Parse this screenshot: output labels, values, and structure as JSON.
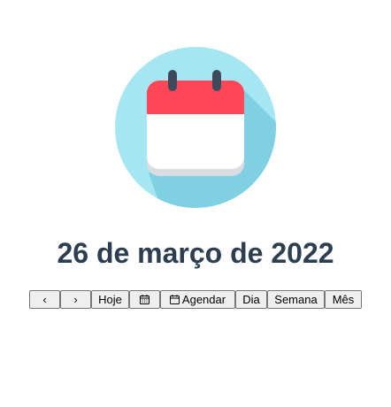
{
  "header": {
    "date_title": "26 de março de 2022"
  },
  "hero": {
    "icon": "calendar-icon",
    "colors": {
      "circle": "#a6e6f2",
      "shadow": "#7fd0e2",
      "header_red": "#ff4757",
      "page_white": "#ffffff",
      "page_edge": "#d9dde3",
      "rings": "#3d4a5c"
    }
  },
  "toolbar": {
    "prev_label": "‹",
    "next_label": "›",
    "today_label": "Hoje",
    "calendar_icon": "calendar-icon",
    "agenda_label": "Agendar",
    "day_label": "Dia",
    "week_label": "Semana",
    "month_label": "Mês"
  }
}
